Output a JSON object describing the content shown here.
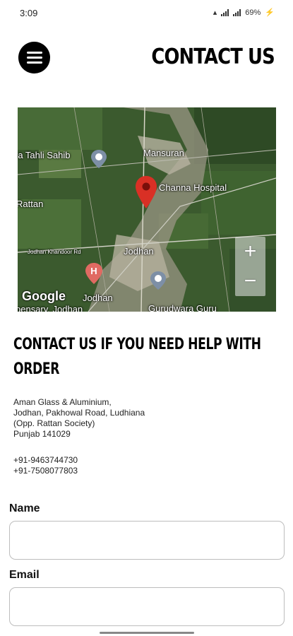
{
  "status_bar": {
    "time": "3:09",
    "battery": "69%"
  },
  "header": {
    "menu_icon": "hamburger-menu-icon",
    "title": "CONTACT US"
  },
  "map": {
    "labels": {
      "tahli_sahib": "ra Tahli Sahib",
      "mansuran": "Mansuran",
      "channa_hospital": "Channa Hospital",
      "rattan": "Rattan",
      "jodhan_khandoor": "Jodhan Khandoor Rd",
      "jodhan": "Jodhan",
      "jodhan_lower": "Jodhan",
      "jodhan_dispensary": "pensary, Jodhan",
      "gurudwara": "Gurudwara Guru"
    },
    "zoom_in": "+",
    "zoom_out": "−",
    "logo": "Google",
    "icons": [
      "map-pin-icon",
      "hospital-marker-icon",
      "temple-marker-icon"
    ]
  },
  "contact": {
    "heading": "CONTACT US IF YOU NEED HELP WITH ORDER",
    "address_lines": [
      "Aman Glass & Aluminium,",
      "Jodhan, Pakhowal Road, Ludhiana",
      "(Opp. Rattan Society)",
      "Punjab 141029"
    ],
    "phones": [
      "+91-9463744730",
      "+91-7508077803"
    ]
  },
  "form": {
    "name_label": "Name",
    "name_value": "",
    "email_label": "Email",
    "email_value": ""
  },
  "colors": {
    "accent": "#000000",
    "pin": "#d93025",
    "map_bg": "#36512b"
  }
}
